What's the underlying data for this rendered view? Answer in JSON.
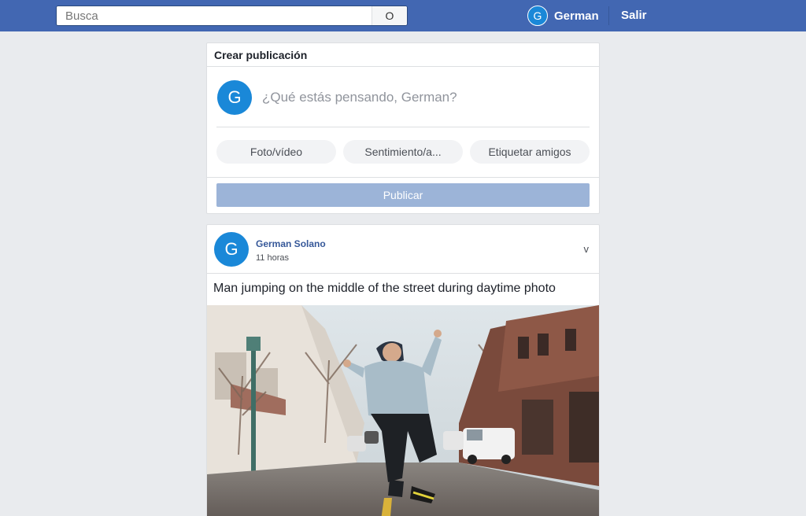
{
  "header": {
    "search_placeholder": "Busca",
    "search_button": "O",
    "user_initial": "G",
    "user_name": "German",
    "logout": "Salir"
  },
  "composer": {
    "title": "Crear publicación",
    "avatar_initial": "G",
    "placeholder": "¿Qué estás pensando, German?",
    "actions": [
      "Foto/vídeo",
      "Sentimiento/a...",
      "Etiquetar amigos"
    ],
    "publish": "Publicar"
  },
  "post": {
    "avatar_initial": "G",
    "author": "German Solano",
    "time": "11 horas",
    "menu": "v",
    "text": "Man jumping on the middle of the street during daytime photo",
    "photo_icon": "street-photo"
  },
  "colors": {
    "topbar": "#4267b2",
    "avatar": "#1a88d8",
    "link": "#365899",
    "publish_disabled": "#9cb4d8",
    "background": "#e9ebee"
  }
}
